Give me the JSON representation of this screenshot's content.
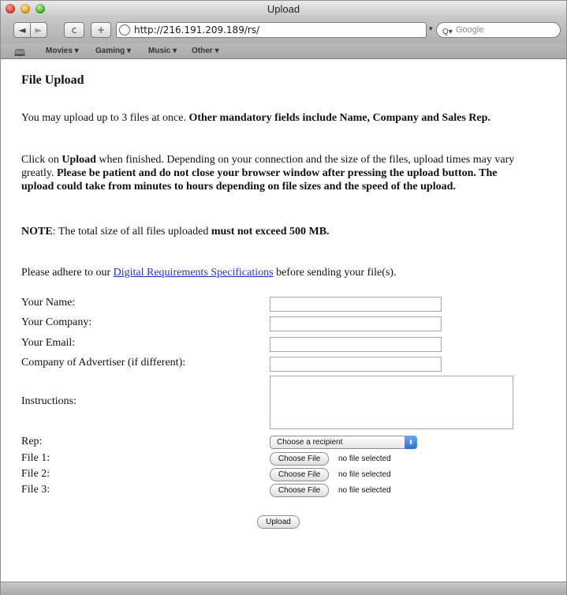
{
  "window": {
    "title": "Upload"
  },
  "toolbar": {
    "back_icon": "◄",
    "forward_icon": "►",
    "reload_icon": "c",
    "add_icon": "+",
    "url": "http://216.191.209.189/rs/",
    "search_icon": "Q▾",
    "search_placeholder": "Google"
  },
  "bookmarks": {
    "book_icon": "🕮",
    "items": [
      "Movies ▾",
      "Gaming ▾",
      "Music ▾",
      "Other ▾"
    ]
  },
  "page": {
    "heading": "File Upload",
    "p1_a": "You may upload up to 3 files at once. ",
    "p1_b": "Other mandatory fields include Name, Company and Sales Rep.",
    "p2_a": "Click on ",
    "p2_b": "Upload",
    "p2_c": " when finished. Depending on your connection and the size of the files, upload times may vary greatly. ",
    "p2_d": "Please be patient and do not close your browser window after pressing the upload button. The upload could take from minutes to hours depending on file sizes and the speed of the upload.",
    "p3_a": "NOTE",
    "p3_b": ": The total size of all files uploaded ",
    "p3_c": "must not exceed 500 MB.",
    "p4_a": "Please adhere to our ",
    "p4_link": "Digital Requirements Specifications",
    "p4_b": " before sending your file(s)."
  },
  "form": {
    "name_label": "Your Name:",
    "company_label": "Your Company:",
    "email_label": "Your Email:",
    "advertiser_label": "Company of Advertiser (if different):",
    "instructions_label": "Instructions:",
    "rep_label": "Rep:",
    "rep_selected": "Choose a recipient",
    "rep_arrow": "⬍",
    "file1_label": "File 1:",
    "file2_label": "File 2:",
    "file3_label": "File 3:",
    "choose_file": "Choose File",
    "no_file": "no file selected",
    "upload_button": "Upload"
  }
}
